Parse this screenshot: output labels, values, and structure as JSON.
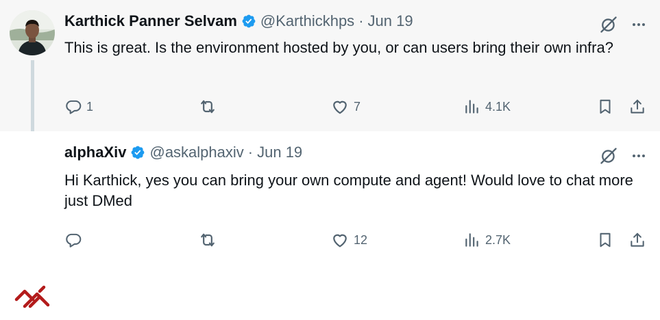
{
  "tweets": [
    {
      "author_name": "Karthick Panner Selvam",
      "handle": "@Karthickhps",
      "separator": "·",
      "date": "Jun 19",
      "text": "This is great. Is the environment hosted by you, or can users bring their own infra?",
      "replies": "1",
      "reposts": "",
      "likes": "7",
      "views": "4.1K"
    },
    {
      "author_name": "alphaXiv",
      "handle": "@askalphaxiv",
      "separator": "·",
      "date": "Jun 19",
      "text": "Hi Karthick, yes you can bring your own compute and agent! Would love to chat more just DMed",
      "replies": "",
      "reposts": "",
      "likes": "12",
      "views": "2.7K"
    }
  ],
  "icons": {
    "verified": "verified-badge-icon",
    "grok": "grok-icon",
    "more": "more-icon",
    "reply": "reply-icon",
    "repost": "repost-icon",
    "like": "heart-icon",
    "views": "views-icon",
    "bookmark": "bookmark-icon",
    "share": "share-icon"
  },
  "colors": {
    "verified_blue": "#1d9bf0",
    "secondary_text": "#536471",
    "alphaxiv_red": "#b31b1b"
  }
}
